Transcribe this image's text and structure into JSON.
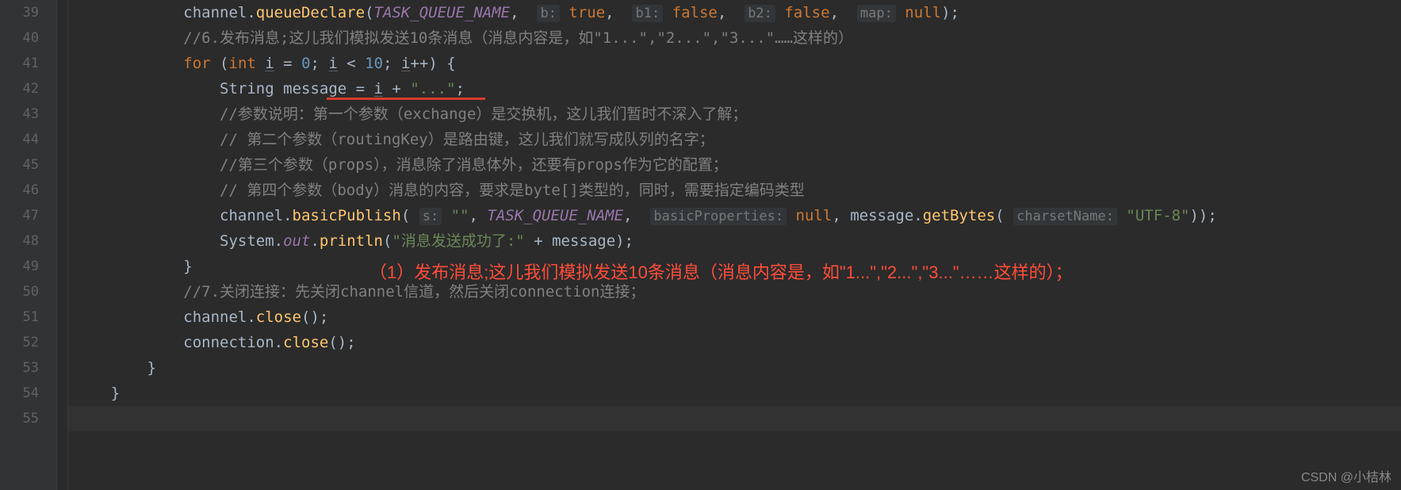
{
  "gutter": {
    "start": 39,
    "end": 55
  },
  "lines": {
    "l39": {
      "indent": "            ",
      "parts": [
        "channel.",
        "queueDeclare",
        "(",
        "TASK_QUEUE_NAME",
        ",  ",
        "b:",
        " ",
        "true",
        ",  ",
        "b1:",
        " ",
        "false",
        ",  ",
        "b2:",
        " ",
        "false",
        ",  ",
        "map:",
        " ",
        "null",
        ");"
      ]
    },
    "l40": {
      "indent": "            ",
      "comment": "//6.发布消息;这儿我们模拟发送10条消息（消息内容是，如\"1...\",\"2...\",\"3...\"……这样的）"
    },
    "l41": {
      "indent": "            ",
      "for_kw": "for",
      "int_kw": "int",
      "var_i": "i",
      "eq": " = ",
      "zero": "0",
      "lt": " < ",
      "ten": "10",
      "inc": "++",
      "tail": ") {"
    },
    "l42": {
      "indent": "                ",
      "type": "String",
      "var": "message",
      "eq": " = ",
      "var_i": "i",
      "plus": " + ",
      "str": "\"...\"",
      "semi": ";"
    },
    "l43": {
      "indent": "                ",
      "comment": "//参数说明：第一个参数（exchange）是交换机，这儿我们暂时不深入了解；"
    },
    "l44": {
      "indent": "                ",
      "comment": "// 第二个参数（routingKey）是路由键，这儿我们就写成队列的名字；"
    },
    "l45": {
      "indent": "                ",
      "comment": "//第三个参数（props），消息除了消息体外，还要有props作为它的配置；"
    },
    "l46": {
      "indent": "                ",
      "comment": "// 第四个参数（body）消息的内容，要求是byte[]类型的，同时，需要指定编码类型"
    },
    "l47": {
      "indent": "                ",
      "pre": "channel.",
      "method": "basicPublish",
      "open": "( ",
      "hint1": "s:",
      "str1": " \"\"",
      "c1": ", ",
      "const": "TASK_QUEUE_NAME",
      "c2": ",  ",
      "hint2": "basicProperties:",
      "null": " null",
      "c3": ", message.",
      "method2": "getBytes",
      "open2": "( ",
      "hint3": "charsetName:",
      "str2": " \"UTF-8\"",
      "close": "));"
    },
    "l48": {
      "indent": "                ",
      "sys": "System.",
      "out": "out",
      "dot": ".",
      "method": "println",
      "open": "(",
      "str": "\"消息发送成功了:\"",
      "plus": " + message);"
    },
    "l49": {
      "indent": "            ",
      "brace": "}"
    },
    "l50": {
      "indent": "            ",
      "comment": "//7.关闭连接：先关闭channel信道，然后关闭connection连接；"
    },
    "l51": {
      "indent": "            ",
      "text": "channel.",
      "method": "close",
      "tail": "();"
    },
    "l52": {
      "indent": "            ",
      "text": "connection.",
      "method": "close",
      "tail": "();"
    },
    "l53": {
      "indent": "        ",
      "brace": "}"
    },
    "l54": {
      "indent": "    ",
      "brace": "}"
    },
    "l55": {
      "indent": "",
      "text": ""
    }
  },
  "annotation": "（1）发布消息;这儿我们模拟发送10条消息（消息内容是，如\"1...\",\"2...\",\"3...\"……这样的）；",
  "watermark": "CSDN @小桔林"
}
